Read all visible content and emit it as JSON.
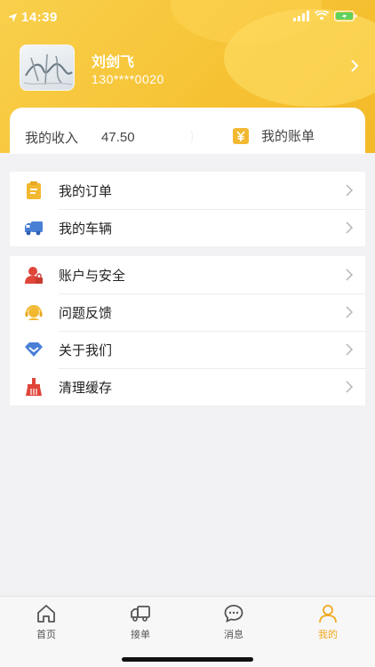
{
  "status": {
    "time": "14:39"
  },
  "profile": {
    "name": "刘剑飞",
    "phone": "130****0020"
  },
  "income": {
    "label": "我的收入",
    "value": "47.50",
    "bill_label": "我的账单"
  },
  "menu_group1": [
    {
      "label": "我的订单",
      "icon": "clipboard-icon"
    },
    {
      "label": "我的车辆",
      "icon": "truck-icon"
    }
  ],
  "menu_group2": [
    {
      "label": "账户与安全",
      "icon": "user-lock-icon"
    },
    {
      "label": "问题反馈",
      "icon": "headset-icon"
    },
    {
      "label": "关于我们",
      "icon": "diamond-icon"
    },
    {
      "label": "清理缓存",
      "icon": "broom-icon"
    }
  ],
  "tabs": [
    {
      "label": "首页",
      "icon": "home-icon"
    },
    {
      "label": "接单",
      "icon": "truck-outline-icon"
    },
    {
      "label": "消息",
      "icon": "chat-icon"
    },
    {
      "label": "我的",
      "icon": "person-icon"
    }
  ],
  "colors": {
    "brand": "#f6c335",
    "active_tab": "#f0a920",
    "icon_red": "#e0453a",
    "icon_blue": "#4a7fd6",
    "icon_yellow": "#f2b830"
  }
}
